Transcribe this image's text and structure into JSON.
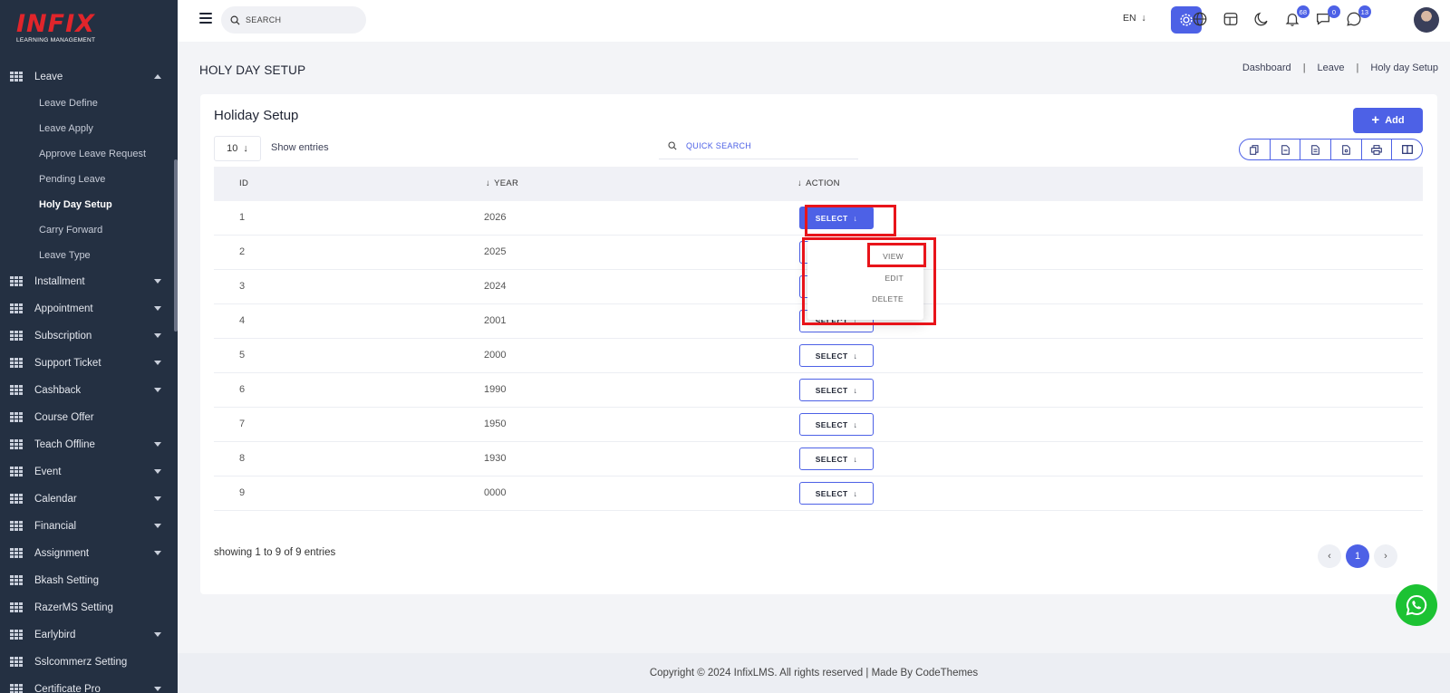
{
  "brand": {
    "name": "INFIX",
    "tagline": "LEARNING MANAGEMENT"
  },
  "sidebar": {
    "leave": {
      "label": "Leave",
      "icon": "grid-icon",
      "expanded": true
    },
    "leave_sub": [
      {
        "label": "Leave Define"
      },
      {
        "label": "Leave Apply"
      },
      {
        "label": "Approve Leave Request"
      },
      {
        "label": "Pending Leave"
      },
      {
        "label": "Holy Day Setup",
        "active": true
      },
      {
        "label": "Carry Forward"
      },
      {
        "label": "Leave Type"
      }
    ],
    "items": [
      {
        "label": "Installment",
        "has_caret": true
      },
      {
        "label": "Appointment",
        "has_caret": true
      },
      {
        "label": "Subscription",
        "has_caret": true
      },
      {
        "label": "Support Ticket",
        "has_caret": true
      },
      {
        "label": "Cashback",
        "has_caret": true
      },
      {
        "label": "Course Offer",
        "has_caret": false
      },
      {
        "label": "Teach Offline",
        "has_caret": true
      },
      {
        "label": "Event",
        "has_caret": true
      },
      {
        "label": "Calendar",
        "has_caret": true
      },
      {
        "label": "Financial",
        "has_caret": true
      },
      {
        "label": "Assignment",
        "has_caret": true
      },
      {
        "label": "Bkash Setting",
        "has_caret": false
      },
      {
        "label": "RazerMS Setting",
        "has_caret": false
      },
      {
        "label": "Earlybird",
        "has_caret": true
      },
      {
        "label": "Sslcommerz Setting",
        "has_caret": false
      },
      {
        "label": "Certificate Pro",
        "has_caret": true
      }
    ]
  },
  "topbar": {
    "search_placeholder": "SEARCH",
    "language": "EN",
    "notifications_count": "68",
    "messages_count": "0",
    "chat_count": "13",
    "accent_color": "#4d61e6"
  },
  "page": {
    "title": "HOLY DAY SETUP",
    "breadcrumb": [
      "Dashboard",
      "Leave",
      "Holy day Setup"
    ],
    "breadcrumb_sep": "|"
  },
  "card": {
    "title": "Holiday Setup",
    "add_label": "Add",
    "entries_value": "10",
    "entries_label": "Show entries",
    "quick_search_placeholder": "QUICK SEARCH",
    "export_buttons": [
      "copy-icon",
      "csv-icon",
      "excel-icon",
      "pdf-icon",
      "print-icon",
      "columns-icon"
    ]
  },
  "table": {
    "columns": [
      "ID",
      "YEAR",
      "ACTION"
    ],
    "select_label": "SELECT",
    "rows": [
      {
        "id": "1",
        "year": "2026"
      },
      {
        "id": "2",
        "year": "2025"
      },
      {
        "id": "3",
        "year": "2024"
      },
      {
        "id": "4",
        "year": "2001"
      },
      {
        "id": "5",
        "year": "2000"
      },
      {
        "id": "6",
        "year": "1990"
      },
      {
        "id": "7",
        "year": "1950"
      },
      {
        "id": "8",
        "year": "1930"
      },
      {
        "id": "9",
        "year": "0000"
      }
    ]
  },
  "dropdown": {
    "items": [
      "VIEW",
      "EDIT",
      "DELETE"
    ]
  },
  "pagination": {
    "showing": "showing 1 to 9 of 9 entries",
    "current_page": "1"
  },
  "footer": {
    "text": "Copyright © 2024 InfixLMS. All rights reserved | Made By CodeThemes"
  },
  "highlight_color": "#e8141a"
}
